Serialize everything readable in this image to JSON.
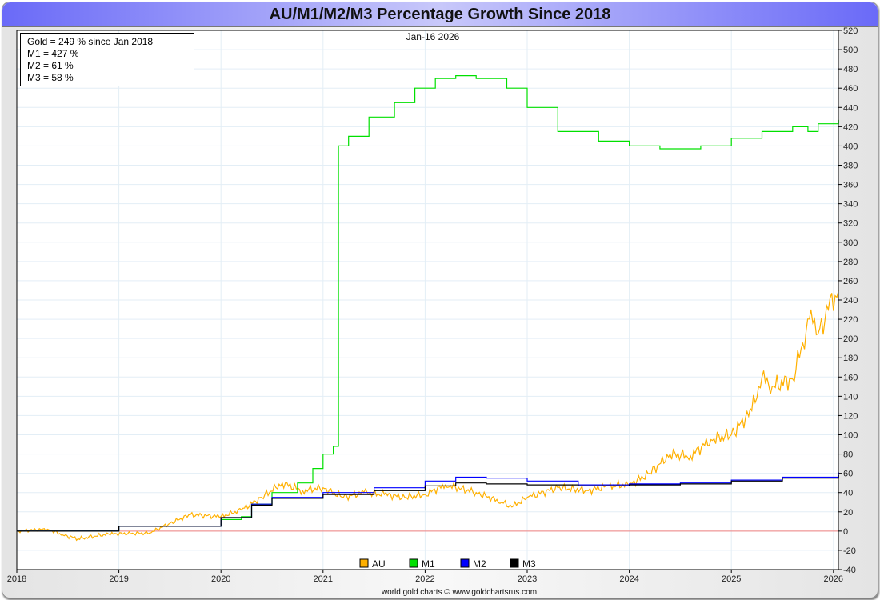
{
  "chart_data": {
    "type": "line",
    "title": "AU/M1/M2/M3 Percentage Growth Since 2018",
    "date_label": "Jan-16  2026",
    "info_lines": [
      "Gold = 249 % since Jan 2018",
      "M1 = 427 %",
      "M2 = 61 %",
      "M3 = 58 %"
    ],
    "footer": "world gold charts © www.goldchartsrus.com",
    "xlim": [
      2018,
      2026.05
    ],
    "ylim": [
      -40,
      520
    ],
    "x_ticks": [
      "2018",
      "2019",
      "2020",
      "2021",
      "2022",
      "2023",
      "2024",
      "2025",
      "2026"
    ],
    "y_ticks": [
      -40,
      -20,
      0,
      20,
      40,
      60,
      80,
      100,
      120,
      140,
      160,
      180,
      200,
      220,
      240,
      260,
      280,
      300,
      320,
      340,
      360,
      380,
      400,
      420,
      440,
      460,
      480,
      500,
      520
    ],
    "grid": true,
    "legend_position": "bottom-center",
    "series": [
      {
        "name": "AU",
        "color": "#ffb000",
        "x": [
          2018,
          2018.3,
          2018.45,
          2018.6,
          2018.9,
          2019.3,
          2019.5,
          2019.7,
          2020.0,
          2020.2,
          2020.4,
          2020.6,
          2020.8,
          2021.0,
          2021.2,
          2021.4,
          2021.6,
          2021.8,
          2022.0,
          2022.2,
          2022.5,
          2022.75,
          2022.85,
          2023.0,
          2023.3,
          2023.6,
          2023.8,
          2024.0,
          2024.2,
          2024.4,
          2024.6,
          2024.8,
          2025.0,
          2025.2,
          2025.3,
          2025.4,
          2025.6,
          2025.7,
          2025.78,
          2025.85,
          2025.95,
          2026.05
        ],
        "y": [
          0,
          2,
          -4,
          -8,
          -3,
          -2,
          8,
          17,
          15,
          22,
          35,
          50,
          42,
          45,
          35,
          40,
          38,
          35,
          38,
          48,
          40,
          30,
          25,
          35,
          45,
          42,
          47,
          48,
          60,
          80,
          78,
          95,
          100,
          125,
          160,
          150,
          158,
          195,
          230,
          205,
          230,
          250
        ]
      },
      {
        "name": "M1",
        "color": "#00e000",
        "x": [
          2018,
          2019,
          2020,
          2020.2,
          2020.3,
          2020.5,
          2020.75,
          2020.9,
          2021.0,
          2021.1,
          2021.15,
          2021.151,
          2021.25,
          2021.45,
          2021.7,
          2021.9,
          2022.1,
          2022.3,
          2022.5,
          2022.8,
          2023.0,
          2023.3,
          2023.7,
          2024.0,
          2024.3,
          2024.7,
          2025.0,
          2025.3,
          2025.6,
          2025.75,
          2025.85,
          2026.05
        ],
        "y": [
          0,
          5,
          12,
          15,
          28,
          40,
          50,
          65,
          80,
          88,
          88,
          400,
          410,
          430,
          445,
          460,
          470,
          473,
          470,
          460,
          440,
          415,
          405,
          400,
          397,
          400,
          408,
          415,
          420,
          415,
          423,
          427
        ]
      },
      {
        "name": "M2",
        "color": "#0000ff",
        "x": [
          2018,
          2019,
          2020,
          2020.3,
          2020.5,
          2021,
          2021.5,
          2022,
          2022.3,
          2022.6,
          2023,
          2023.5,
          2024,
          2024.5,
          2025,
          2025.5,
          2026.05
        ],
        "y": [
          0,
          5,
          14,
          28,
          35,
          40,
          45,
          52,
          56,
          55,
          52,
          48,
          49,
          50,
          53,
          56,
          61
        ]
      },
      {
        "name": "M3",
        "color": "#000000",
        "x": [
          2018,
          2019,
          2020,
          2020.3,
          2020.5,
          2021,
          2021.5,
          2022,
          2022.3,
          2022.6,
          2023,
          2023.5,
          2024,
          2024.5,
          2025,
          2025.5,
          2026.05
        ],
        "y": [
          0,
          5,
          14,
          27,
          34,
          38,
          42,
          47,
          50,
          49,
          48,
          47,
          48,
          49,
          52,
          55,
          58
        ]
      }
    ]
  }
}
